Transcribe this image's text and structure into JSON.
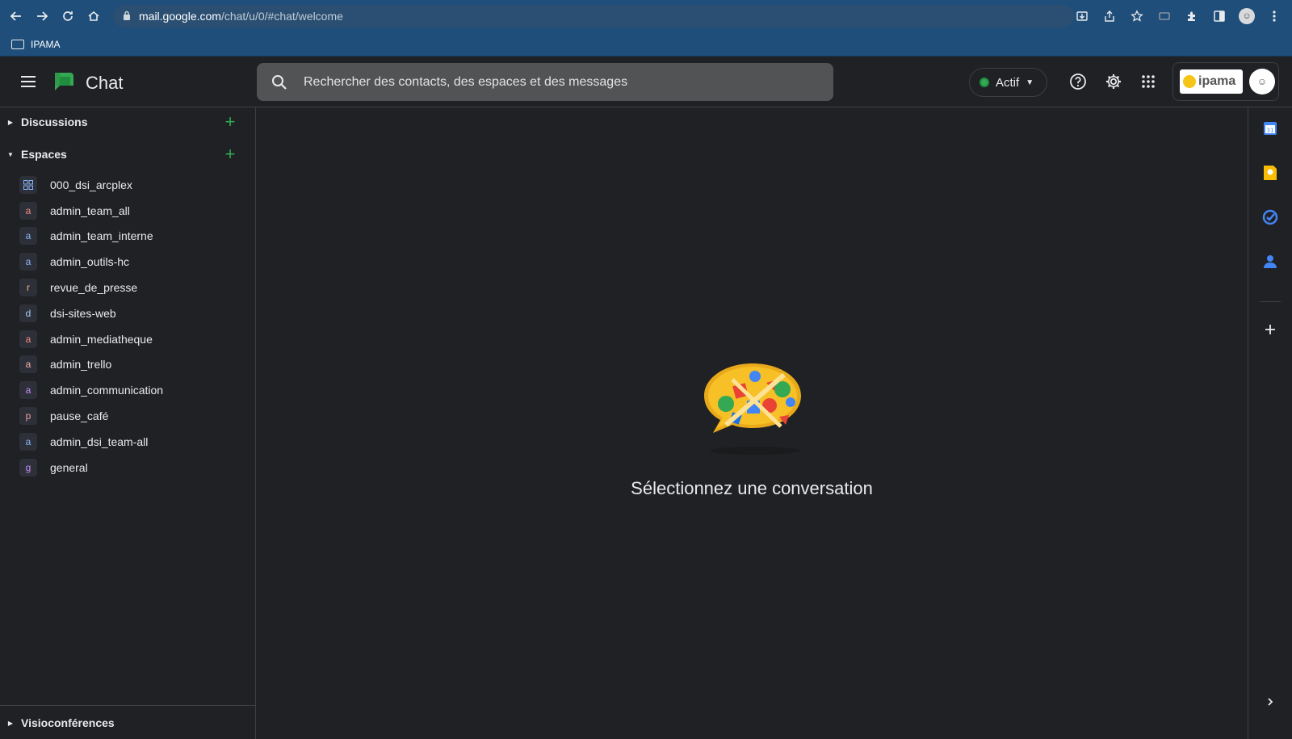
{
  "browser": {
    "url_host": "mail.google.com",
    "url_path": "/chat/u/0/#chat/welcome",
    "bookmark": "IPAMA"
  },
  "header": {
    "app_title": "Chat",
    "search_placeholder": "Rechercher des contacts, des espaces et des messages",
    "status_label": "Actif",
    "org_logo_text": "ipama"
  },
  "sidebar": {
    "discussions_label": "Discussions",
    "spaces_label": "Espaces",
    "footer_label": "Visioconférences",
    "spaces": [
      {
        "initial": "",
        "name": "000_dsi_arcplex",
        "color": "#8ab4f8"
      },
      {
        "initial": "a",
        "name": "admin_team_all",
        "color": "#f28b82"
      },
      {
        "initial": "a",
        "name": "admin_team_interne",
        "color": "#8ab4f8"
      },
      {
        "initial": "a",
        "name": "admin_outils-hc",
        "color": "#8ab4f8"
      },
      {
        "initial": "r",
        "name": "revue_de_presse",
        "color": "#fcad70"
      },
      {
        "initial": "d",
        "name": "dsi-sites-web",
        "color": "#aecbfa"
      },
      {
        "initial": "a",
        "name": "admin_mediatheque",
        "color": "#f28b82"
      },
      {
        "initial": "a",
        "name": "admin_trello",
        "color": "#f6aea9"
      },
      {
        "initial": "a",
        "name": "admin_communication",
        "color": "#c58af9"
      },
      {
        "initial": "p",
        "name": "pause_café",
        "color": "#e8a0a0"
      },
      {
        "initial": "a",
        "name": "admin_dsi_team-all",
        "color": "#8ab4f8"
      },
      {
        "initial": "g",
        "name": "general",
        "color": "#c58af9"
      }
    ]
  },
  "main": {
    "empty_title": "Sélectionnez une conversation"
  },
  "colors": {
    "background": "#202124",
    "chrome": "#1f4e7a",
    "accent_green": "#34a853"
  }
}
